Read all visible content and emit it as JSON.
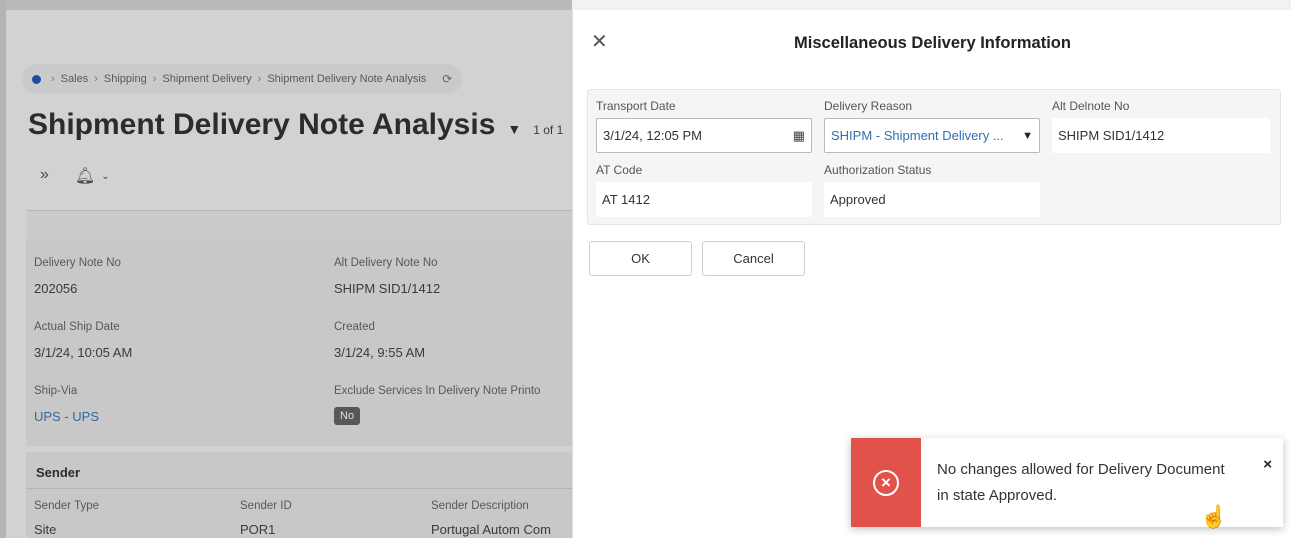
{
  "background": {
    "breadcrumb": [
      "Sales",
      "Shipping",
      "Shipment Delivery",
      "Shipment Delivery Note Analysis"
    ],
    "page_title": "Shipment Delivery Note Analysis",
    "pager": "1 of 1",
    "fields": {
      "delivery_note_no_label": "Delivery Note No",
      "delivery_note_no": "202056",
      "alt_delivery_note_no_label": "Alt Delivery Note No",
      "alt_delivery_note_no": "SHIPM SID1/1412",
      "actual_ship_date_label": "Actual Ship Date",
      "actual_ship_date": "3/1/24, 10:05 AM",
      "created_label": "Created",
      "created": "3/1/24, 9:55 AM",
      "ship_via_label": "Ship-Via",
      "ship_via": "UPS - UPS",
      "exclude_services_label": "Exclude Services In Delivery Note Printo",
      "exclude_services": "No"
    },
    "sender": {
      "title": "Sender",
      "type_label": "Sender Type",
      "id_label": "Sender ID",
      "description_label": "Sender Description",
      "type": "Site",
      "id": "POR1",
      "description": "Portugal Autom Com"
    }
  },
  "dialog": {
    "title": "Miscellaneous Delivery Information",
    "transport_date_label": "Transport Date",
    "transport_date": "3/1/24, 12:05 PM",
    "delivery_reason_label": "Delivery Reason",
    "delivery_reason": "SHIPM - Shipment Delivery ...",
    "alt_delnote_no_label": "Alt Delnote No",
    "alt_delnote_no": "SHIPM SID1/1412",
    "at_code_label": "AT Code",
    "at_code": "AT 1412",
    "authorization_status_label": "Authorization Status",
    "authorization_status": "Approved",
    "ok_label": "OK",
    "cancel_label": "Cancel"
  },
  "toast": {
    "message": "No changes allowed for Delivery Document in state Approved.",
    "close_symbol": "×"
  },
  "colors": {
    "error_red": "#e0524a",
    "link_blue": "#2f6fb3"
  }
}
